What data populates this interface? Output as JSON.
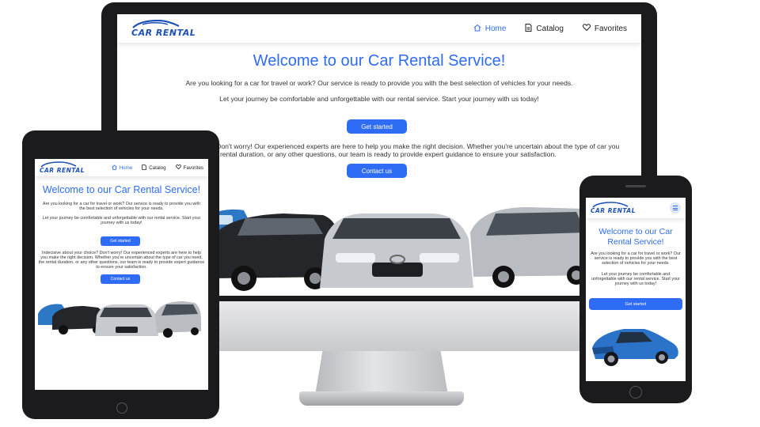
{
  "site": {
    "logo_text": "CAR RENTAL",
    "nav": {
      "home": "Home",
      "catalog": "Catalog",
      "favorites": "Favorites"
    },
    "title": "Welcome to our Car Rental Service!",
    "intro": "Are you looking for a car for travel or work? Our service is ready to provide you with the best selection of vehicles for your needs.",
    "journey": "Let your journey be comfortable and unforgettable with our rental service. Start your journey with us today!",
    "get_started": "Get started",
    "help": "Indecisive about your choice? Don't worry! Our experienced experts are here to help you make the right decision. Whether you're uncertain about the type of car you need, the rental duration, or any other questions, our team is ready to provide expert guidance to ensure your satisfaction.",
    "desktop_help_line1": "? Don't worry! Our experienced experts are here to help you make the right decision. Whether you're uncertain about the type of car you",
    "desktop_help_line2": "he rental duration, or any other questions, our team is ready to provide expert guidance to ensure your satisfaction.",
    "contact_us": "Contact us"
  },
  "colors": {
    "accent": "#2f6cf6",
    "logo": "#1d4fb8",
    "device_frame": "#1b1b1d",
    "monitor_stand": "#c8c9cc"
  },
  "icons": {
    "home": "home-icon",
    "catalog": "document-icon",
    "favorites": "heart-icon",
    "menu": "hamburger-menu-icon"
  }
}
